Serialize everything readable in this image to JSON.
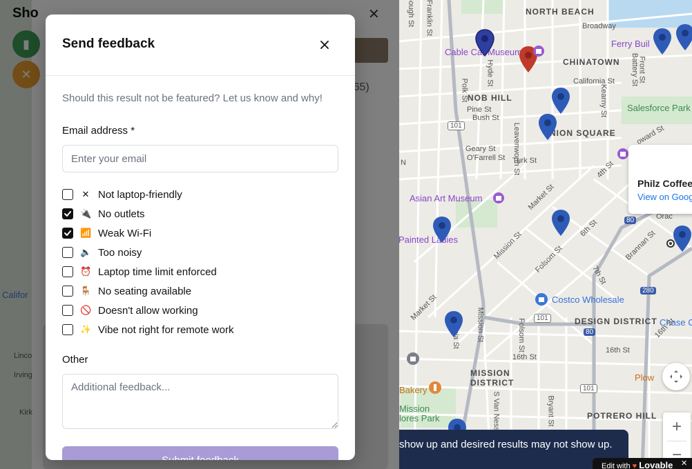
{
  "modal": {
    "title": "Send feedback",
    "subtitle": "Should this result not be featured? Let us know and why!",
    "email_label": "Email address *",
    "email_placeholder": "Enter your email",
    "email_value": "",
    "options": [
      {
        "label": "Not laptop-friendly",
        "icon": "✕",
        "icon_name": "x-icon",
        "checked": false
      },
      {
        "label": "No outlets",
        "icon": "🔌",
        "icon_name": "plug-icon",
        "checked": true
      },
      {
        "label": "Weak Wi-Fi",
        "icon": "📶",
        "icon_name": "signal-bars-icon",
        "checked": true
      },
      {
        "label": "Too noisy",
        "icon": "🔈",
        "icon_name": "speaker-icon",
        "checked": false
      },
      {
        "label": "Laptop time limit enforced",
        "icon": "⏰",
        "icon_name": "alarm-clock-icon",
        "checked": false
      },
      {
        "label": "No seating available",
        "icon": "🪑",
        "icon_name": "chair-icon",
        "checked": false
      },
      {
        "label": "Doesn't allow working",
        "icon": "🚫",
        "icon_name": "prohibited-icon",
        "checked": false
      },
      {
        "label": "Vibe not right for remote work",
        "icon": "✨",
        "icon_name": "sparkles-icon",
        "checked": false
      }
    ],
    "other_label": "Other",
    "other_placeholder": "Additional feedback...",
    "submit_label": "Submit feedback",
    "accent_color": "#a89bd6"
  },
  "background_panel": {
    "title": "Sho",
    "rating_text": "5 (365)"
  },
  "map": {
    "labels": {
      "north_beach": "NORTH BEACH",
      "chinatown": "CHINATOWN",
      "nob_hill": "NOB HILL",
      "union_square": "NION SQUARE",
      "design_district": "DESIGN DISTRICT",
      "mission_district_1": "MISSION",
      "mission_district_2": "DISTRICT",
      "potrero_hill": "POTRERO HILL",
      "cable_car_museum": "Cable Car Museum",
      "ferry_building": "Ferry Buil",
      "salesforce_park": "Salesforce Park",
      "asian_art_museum": "Asian Art Museum",
      "painted_ladies": "Painted Ladies",
      "costco": "Costco Wholesale",
      "chase": "Chase C",
      "bakery": "Bakery",
      "plow": "Plow",
      "mission_dolores": "Mission",
      "mission_dolores_2": "lores Park",
      "california": "Califor",
      "broadway": "Broadway",
      "california_st": "California St",
      "pine_st": "Pine St",
      "bush_st": "Bush St",
      "geary_st": "Geary St",
      "ofarrell_st": "O'Farrell St",
      "turk_st": "Turk St",
      "market_st": "Market St",
      "mission_st": "Mission St",
      "folsom_st": "Folsom St",
      "sixth_st": "6th St",
      "seventh_st": "7th St",
      "fourth_st": "4th St",
      "brannan_st": "Brannan St",
      "sixteenth_st": "16th St",
      "sixteenth_st_2": "16th St",
      "kearny_st": "Kearny St",
      "polk_st": "Polk St",
      "hyde_st": "Hyde St",
      "leavenworth_st": "Leavenworth St",
      "valencia_st": "encia St",
      "s_van_ness": "S Van Ness",
      "bryant_st": "Bryant St",
      "franklin_st": "Franklin St",
      "gough_st": "Gough St",
      "battery_st": "Battery St",
      "front_st": "Front St",
      "howard_st": "oward St",
      "orac": "Orac",
      "lincoln": "Linco",
      "irving": "Irving",
      "kirk": "Kirk",
      "n": "N",
      "hw101": "101",
      "hw80": "80",
      "hw280": "280",
      "hw1": "1"
    },
    "info_card": {
      "name": "Philz Coffee",
      "link": "View on Goog"
    },
    "banner_text": "show up and desired results may not show up.",
    "lovable": {
      "prefix": "Edit with",
      "brand": "Lovable"
    },
    "zoom_in": "+",
    "zoom_out": "−"
  }
}
